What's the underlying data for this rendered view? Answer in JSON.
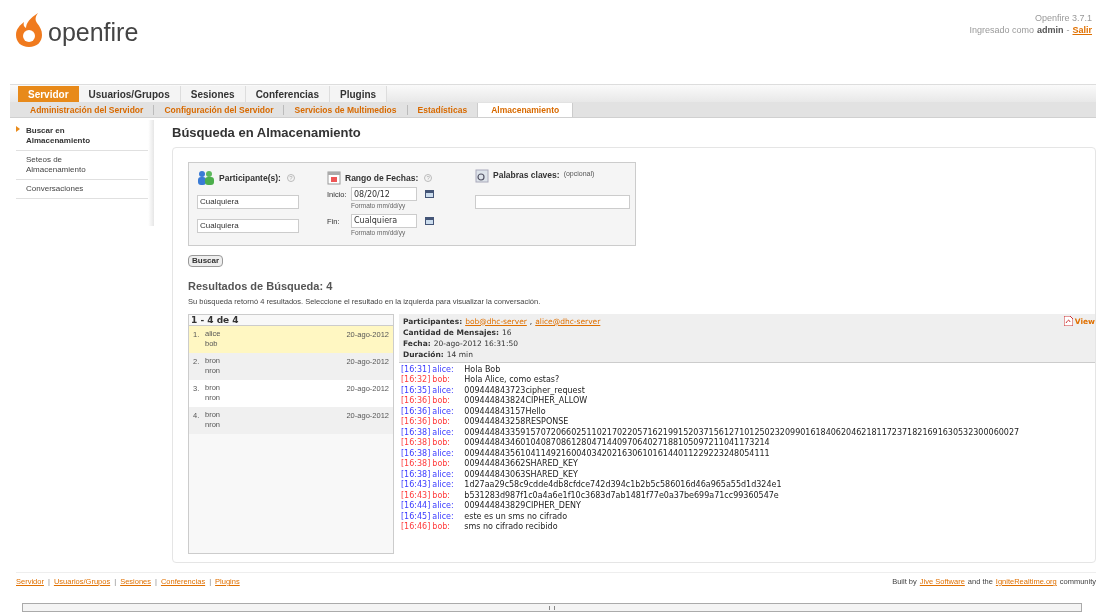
{
  "header": {
    "version": "Openfire 3.7.1",
    "login_prefix": "Ingresado como",
    "login_user": "admin",
    "separator": "-",
    "logout": "Salir",
    "logo_text": "openfire"
  },
  "main_tabs": [
    {
      "label": "Servidor",
      "selected": true
    },
    {
      "label": "Usuarios/Grupos",
      "selected": false
    },
    {
      "label": "Sesiones",
      "selected": false
    },
    {
      "label": "Conferencias",
      "selected": false
    },
    {
      "label": "Plugins",
      "selected": false
    }
  ],
  "sub_tabs": [
    {
      "label": "Administración del Servidor",
      "selected": false
    },
    {
      "label": "Configuración del Servidor",
      "selected": false
    },
    {
      "label": "Servicios de Multimedios",
      "selected": false
    },
    {
      "label": "Estadísticas",
      "selected": false
    },
    {
      "label": "Almacenamiento",
      "selected": true
    }
  ],
  "sidebar": {
    "items": [
      {
        "label": "Buscar en Almacenamiento",
        "selected": true
      },
      {
        "label": "Seteos de Almacenamiento",
        "selected": false
      },
      {
        "label": "Conversaciones",
        "selected": false
      }
    ]
  },
  "page_title": "Búsqueda en Almacenamiento",
  "search": {
    "participants": {
      "label": "Participante(s):",
      "help": "?",
      "values": [
        "Cualquiera",
        "Cualquiera"
      ]
    },
    "dates": {
      "label": "Rango de Fechas:",
      "help": "?",
      "start_label": "Inicio:",
      "start": "08/20/12",
      "start_hint": "Formato mm/dd/yy",
      "end_label": "Fin:",
      "end": "Cualquiera",
      "end_hint": "Formato mm/dd/yy"
    },
    "keywords": {
      "label": "Palabras claves:",
      "optional": "(opcional)"
    },
    "button": "Buscar"
  },
  "results": {
    "title": "Resultados de Búsqueda: 4",
    "summary": "Su búsqueda retornó 4 resultados. Seleccione el resultado en la izquierda para visualizar la conversación.",
    "range": "1 - 4 de 4",
    "rows": [
      {
        "index": "1.",
        "user1": "alice",
        "user2": "bob",
        "date": "20-ago-2012",
        "selected": true
      },
      {
        "index": "2.",
        "user1": "bron",
        "user2": "nron",
        "date": "20-ago-2012",
        "selected": false
      },
      {
        "index": "3.",
        "user1": "bron",
        "user2": "nron",
        "date": "20-ago-2012",
        "selected": false
      },
      {
        "index": "4.",
        "user1": "bron",
        "user2": "nron",
        "date": "20-ago-2012",
        "selected": false
      }
    ]
  },
  "conversation": {
    "participants_label": "Participantes:",
    "participants": [
      "bob@dhc-server",
      "alice@dhc-server"
    ],
    "participant_separator": ",",
    "count_label": "Cantidad de Mensajes:",
    "count": "16",
    "date_label": "Fecha:",
    "date": "20-ago-2012 16:31:50",
    "duration_label": "Duración:",
    "duration": "14 min",
    "view": "View",
    "messages": [
      {
        "time": "[16:31]",
        "from": "alice:",
        "text": "Hola Bob",
        "kind": "local"
      },
      {
        "time": "[16:32]",
        "from": "bob:",
        "text": "Hola Alice, como estas?",
        "kind": "remote"
      },
      {
        "time": "[16:35]",
        "from": "alice:",
        "text": "009444843723cipher_request",
        "kind": "local"
      },
      {
        "time": "[16:36]",
        "from": "bob:",
        "text": "009444843824CIPHER_ALLOW",
        "kind": "remote"
      },
      {
        "time": "[16:36]",
        "from": "alice:",
        "text": "009444843157Hello",
        "kind": "local"
      },
      {
        "time": "[16:36]",
        "from": "bob:",
        "text": "009444843258RESPONSE",
        "kind": "remote"
      },
      {
        "time": "[16:38]",
        "from": "alice:",
        "text": "0094448433591570720660251102170220571621991520371561271012502320990161840620462181172371821691630532300060027",
        "kind": "local"
      },
      {
        "time": "[16:38]",
        "from": "bob:",
        "text": "009444843460104087086128047144097064027188105097211041173214",
        "kind": "remote"
      },
      {
        "time": "[16:38]",
        "from": "alice:",
        "text": "009444843561041149216004034202163061016144011229223248054111",
        "kind": "local"
      },
      {
        "time": "[16:38]",
        "from": "bob:",
        "text": "009444843662SHARED_KEY",
        "kind": "remote"
      },
      {
        "time": "[16:38]",
        "from": "alice:",
        "text": "009444843063SHARED_KEY",
        "kind": "local"
      },
      {
        "time": "[16:43]",
        "from": "alice:",
        "text": "1d27aa29c58c9cdde4db8cfdce742d394c1b2b5c586016d46a965a55d1d324e1",
        "kind": "local"
      },
      {
        "time": "[16:43]",
        "from": "bob:",
        "text": "b531283d987f1c0a4a6e1f10c3683d7ab1481f77e0a37be699a71cc99360547e",
        "kind": "remote"
      },
      {
        "time": "[16:44]",
        "from": "alice:",
        "text": "009444843829CIPHER_DENY",
        "kind": "local"
      },
      {
        "time": "[16:45]",
        "from": "alice:",
        "text": "este es un sms no cifrado",
        "kind": "local"
      },
      {
        "time": "[16:46]",
        "from": "bob:",
        "text": "sms no cifrado recibido",
        "kind": "remote"
      }
    ]
  },
  "footer": {
    "links": [
      "Servidor",
      "Usuarios/Grupos",
      "Sesiones",
      "Conferencias",
      "Plugins"
    ],
    "separator": "|",
    "credit": [
      {
        "text": "Built by",
        "kind": "text"
      },
      {
        "text": "Jive Software",
        "kind": "link"
      },
      {
        "text": "and the",
        "kind": "text"
      },
      {
        "text": "IgniteRealtime.org",
        "kind": "link"
      },
      {
        "text": "community",
        "kind": "text"
      }
    ]
  }
}
